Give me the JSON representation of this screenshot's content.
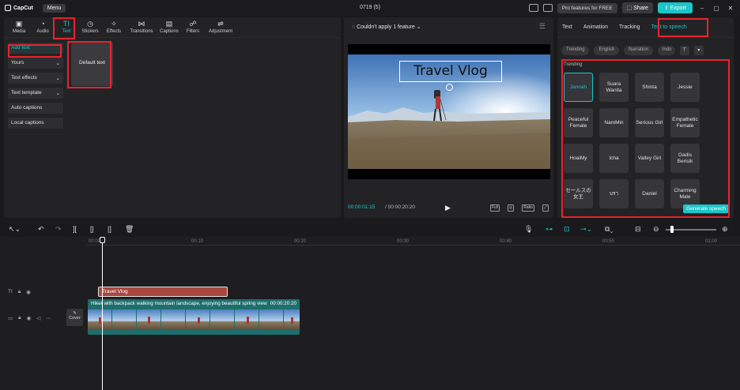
{
  "app": {
    "logo_text": "CapCut",
    "menu_label": "Menu",
    "project_title": "0719 (5)",
    "pro_label": "Pro features for FREE",
    "share_label": "Share",
    "export_label": "Export"
  },
  "categories": [
    {
      "label": "Media",
      "icon": "media-icon",
      "glyph": "▣"
    },
    {
      "label": "Audio",
      "icon": "audio-icon",
      "glyph": "◔"
    },
    {
      "label": "Text",
      "icon": "text-icon",
      "glyph": "TI"
    },
    {
      "label": "Stickers",
      "icon": "sticker-icon",
      "glyph": "◷"
    },
    {
      "label": "Effects",
      "icon": "effects-icon",
      "glyph": "✧"
    },
    {
      "label": "Transitions",
      "icon": "transitions-icon",
      "glyph": "⋈"
    },
    {
      "label": "Captions",
      "icon": "captions-icon",
      "glyph": "▤"
    },
    {
      "label": "Filters",
      "icon": "filters-icon",
      "glyph": "☍"
    },
    {
      "label": "Adjustment",
      "icon": "adjustment-icon",
      "glyph": "⇌"
    }
  ],
  "text_menu": [
    {
      "label": "Add text",
      "arrow": ""
    },
    {
      "label": "Yours",
      "arrow": "⌄"
    },
    {
      "label": "Text effects",
      "arrow": "⌄"
    },
    {
      "label": "Text template",
      "arrow": "⌄"
    },
    {
      "label": "Auto captions",
      "arrow": ""
    },
    {
      "label": "Local captions",
      "arrow": ""
    }
  ],
  "default_text_card": "Default text",
  "player": {
    "header": "Couldn't apply 1 feature",
    "overlay_text": "Travel Vlog",
    "current_time": "00:00:01:15",
    "total_time": "00:00:20:20",
    "ratio_label": "Ratio"
  },
  "right_tabs": [
    "Text",
    "Animation",
    "Tracking",
    "Text to speech"
  ],
  "voice_filters": [
    "Trending",
    "English",
    "Narration",
    "Indo"
  ],
  "trending_label": "Trending",
  "voices": [
    "Jannah",
    "Suara Wanita",
    "Shinta",
    "Jessie",
    "Peaceful Female",
    "NamMin",
    "Serious Girl",
    "Empathetic Female",
    "HoaiMy",
    "Icha",
    "Valley Girl",
    "Gadis Berisik",
    "セールスの女王",
    "บรา",
    "Daniel",
    "Charming Male"
  ],
  "generate_label": "Generate speech",
  "timeline": {
    "ruler": [
      "00:00",
      "00:10",
      "00:20",
      "00:30",
      "00:40",
      "00:50",
      "01:00"
    ],
    "text_clip": "Travel Vlog",
    "video_clip_label": "Hiker with backpack walking mountain landscape, enjoying beautiful spring view",
    "video_clip_duration": "00:00:20:20",
    "cover_label": "Cover"
  },
  "colors": {
    "accent": "#1bc5c9",
    "highlight": "#e8232e",
    "text_clip": "#a8473f",
    "video_clip": "#1e6e6c"
  }
}
